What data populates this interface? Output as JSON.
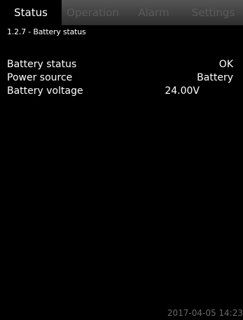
{
  "tabs": [
    {
      "label": "Status",
      "active": true
    },
    {
      "label": "Operation",
      "active": false
    },
    {
      "label": "Alarm",
      "active": false
    },
    {
      "label": "Settings",
      "active": false
    }
  ],
  "breadcrumb": "1.2.7 - Battery status",
  "rows": [
    {
      "label": "Battery status",
      "value": "OK"
    },
    {
      "label": "Power source",
      "value": "Battery"
    },
    {
      "label": "Battery voltage",
      "value": "24.00V"
    }
  ],
  "footer": {
    "timestamp": "2017-04-05 14:23"
  },
  "colors": {
    "background": "#000000",
    "text": "#ffffff",
    "inactive_tab_text": "#5a5a5a",
    "tab_bar_top": "#555555",
    "tab_bar_bottom": "#2e2e2e",
    "timestamp": "#6a6a6a"
  }
}
